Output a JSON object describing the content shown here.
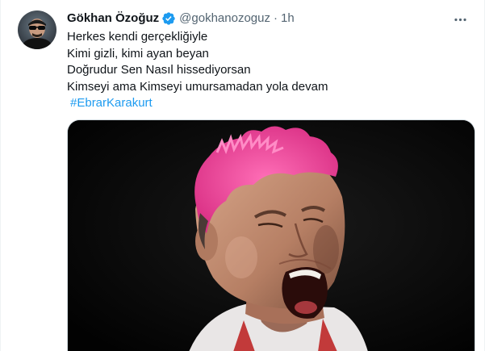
{
  "author": {
    "display_name": "Gökhan Özoğuz",
    "handle": "@gokhanozoguz",
    "separator": "·",
    "time": "1h",
    "verified": true
  },
  "tweet": {
    "lines": [
      "Herkes kendi gerçekliğiyle",
      "Kimi gizli, kimi ayan beyan",
      "Doğrudur Sen Nasıl hissediyorsan",
      "Kimseyi ama Kimseyi umursamadan yola devam"
    ],
    "hashtag": "#EbrarKarakurt"
  },
  "icons": {
    "verified": "verified-badge-icon",
    "more": "more-options-icon"
  },
  "colors": {
    "accent": "#1d9bf0",
    "secondary_text": "#536471",
    "hair": "#f0479a"
  }
}
